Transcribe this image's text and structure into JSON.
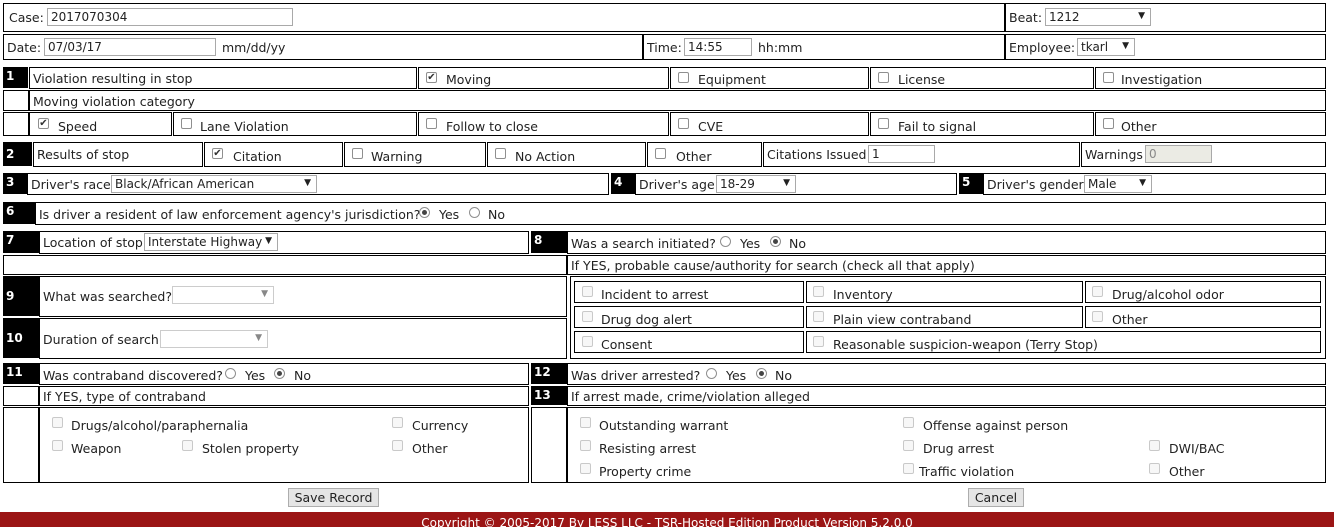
{
  "header": {
    "case_label": "Case:",
    "case_value": "2017070304",
    "beat_label": "Beat:",
    "beat_value": "1212",
    "date_label": "Date:",
    "date_value": "07/03/17",
    "date_hint": "mm/dd/yy",
    "time_label": "Time:",
    "time_value": "14:55",
    "time_hint": "hh:mm",
    "employee_label": "Employee:",
    "employee_value": "tkarl"
  },
  "sec1": {
    "num": "1",
    "label": "Violation resulting in stop",
    "options": [
      {
        "label": "Moving",
        "checked": true
      },
      {
        "label": "Equipment",
        "checked": false
      },
      {
        "label": "License",
        "checked": false
      },
      {
        "label": "Investigation",
        "checked": false
      }
    ],
    "category_label": "Moving violation category",
    "categories": [
      {
        "label": "Speed",
        "checked": true
      },
      {
        "label": "Lane Violation",
        "checked": false
      },
      {
        "label": "Follow to close",
        "checked": false
      },
      {
        "label": "CVE",
        "checked": false
      },
      {
        "label": "Fail to signal",
        "checked": false
      },
      {
        "label": "Other",
        "checked": false
      }
    ]
  },
  "sec2": {
    "num": "2",
    "label": "Results of stop",
    "options": [
      {
        "label": "Citation",
        "checked": true
      },
      {
        "label": "Warning",
        "checked": false
      },
      {
        "label": "No Action",
        "checked": false
      },
      {
        "label": "Other",
        "checked": false
      }
    ],
    "citations_label": "Citations Issued",
    "citations_value": "1",
    "warnings_label": "Warnings",
    "warnings_value": "0"
  },
  "sec3": {
    "num": "3",
    "label": "Driver's race",
    "value": "Black/African American"
  },
  "sec4": {
    "num": "4",
    "label": "Driver's age",
    "value": "18-29"
  },
  "sec5": {
    "num": "5",
    "label": "Driver's gender",
    "value": "Male"
  },
  "sec6": {
    "num": "6",
    "label": "Is driver a resident of law enforcement agency's jurisdiction?",
    "yes": "Yes",
    "no": "No",
    "selected": "Yes"
  },
  "sec7": {
    "num": "7",
    "label": "Location of stop",
    "value": "Interstate Highway"
  },
  "sec8": {
    "num": "8",
    "label": "Was a search initiated?",
    "yes": "Yes",
    "no": "No",
    "selected": "No",
    "cause_label": "If YES, probable cause/authority for search (check all that apply)",
    "causes": [
      "Incident to arrest",
      "Inventory",
      "Drug/alcohol odor",
      "Drug dog alert",
      "Plain view contraband",
      "Other",
      "Consent",
      "Reasonable suspicion-weapon (Terry Stop)"
    ]
  },
  "sec9": {
    "num": "9",
    "label": "What was searched?",
    "value": ""
  },
  "sec10": {
    "num": "10",
    "label": "Duration of search",
    "value": ""
  },
  "sec11": {
    "num": "11",
    "label": "Was contraband discovered?",
    "yes": "Yes",
    "no": "No",
    "selected": "No",
    "type_label": "If YES, type of contraband",
    "types": [
      "Drugs/alcohol/paraphernalia",
      "Currency",
      "Weapon",
      "Stolen property",
      "Other"
    ]
  },
  "sec12": {
    "num": "12",
    "label": "Was driver arrested?",
    "yes": "Yes",
    "no": "No",
    "selected": "No"
  },
  "sec13": {
    "num": "13",
    "label": "If arrest made, crime/violation alleged",
    "items": [
      "Outstanding warrant",
      "Offense against person",
      "Resisting arrest",
      "Drug arrest",
      "DWI/BAC",
      "Property crime",
      "Traffic violation",
      "Other"
    ]
  },
  "actions": {
    "save": "Save Record",
    "cancel": "Cancel"
  },
  "footer": {
    "text": "Copyright © 2005-2017 By LESS LLC - TSR-Hosted Edition Product Version 5.2.0.0"
  },
  "colors": {
    "footer_bg": "#9b1515",
    "number_bg": "#000000"
  }
}
